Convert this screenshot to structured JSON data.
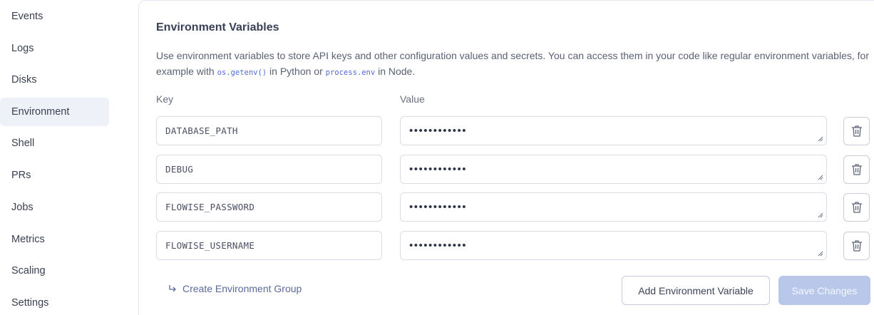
{
  "sidebar": {
    "items": [
      {
        "label": "Events",
        "active": false
      },
      {
        "label": "Logs",
        "active": false
      },
      {
        "label": "Disks",
        "active": false
      },
      {
        "label": "Environment",
        "active": true
      },
      {
        "label": "Shell",
        "active": false
      },
      {
        "label": "PRs",
        "active": false
      },
      {
        "label": "Jobs",
        "active": false
      },
      {
        "label": "Metrics",
        "active": false
      },
      {
        "label": "Scaling",
        "active": false
      },
      {
        "label": "Settings",
        "active": false
      }
    ]
  },
  "main": {
    "title": "Environment Variables",
    "description": {
      "part1": "Use environment variables to store API keys and other configuration values and secrets. You can access them in your code like regular environment variables, for example with ",
      "code1": "os.getenv()",
      "part2": " in Python or ",
      "code2": "process.env",
      "part3": " in Node."
    },
    "key_header": "Key",
    "value_header": "Value",
    "variables": [
      {
        "key": "DATABASE_PATH",
        "value": "••••••••••••"
      },
      {
        "key": "DEBUG",
        "value": "••••••••••••"
      },
      {
        "key": "FLOWISE_PASSWORD",
        "value": "••••••••••••"
      },
      {
        "key": "FLOWISE_USERNAME",
        "value": "••••••••••••"
      }
    ],
    "create_group_label": "Create Environment Group",
    "add_button_label": "Add Environment Variable",
    "save_button_label": "Save Changes"
  },
  "icons": {
    "delete": "trash-icon",
    "create_group": "return-arrow-icon",
    "resize": "resize-grip-icon"
  },
  "colors": {
    "active_nav_bg": "#eef1f8",
    "link": "#5b6a9b",
    "code": "#4f6bd8",
    "save_disabled": "#b9c8ea"
  }
}
